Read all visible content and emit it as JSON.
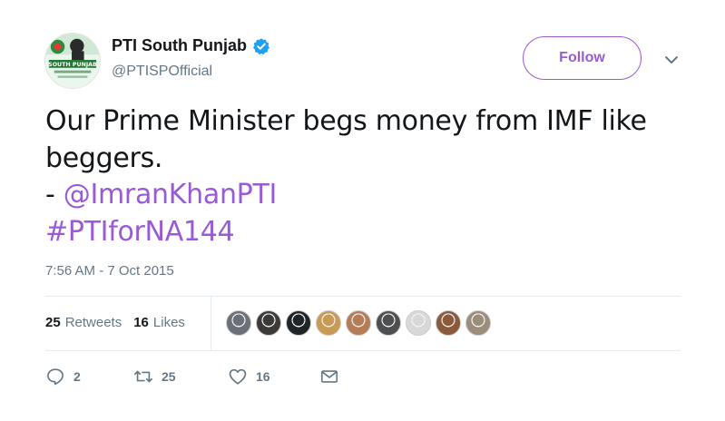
{
  "user": {
    "display_name": "PTI South Punjab",
    "handle": "@PTISPOfficial",
    "avatar_text": "SOUTH PUNJAB"
  },
  "follow_label": "Follow",
  "tweet": {
    "line1": "Our Prime Minister begs money from IMF like",
    "line2": "beggers.",
    "line3_prefix": "- ",
    "mention": "@ImranKhanPTI",
    "hashtag": "#PTIforNA144"
  },
  "timestamp": "7:56 AM - 7 Oct 2015",
  "stats": {
    "retweets_count": "25",
    "retweets_label": "Retweets",
    "likes_count": "16",
    "likes_label": "Likes"
  },
  "liker_avatars": [
    "#6a6f78",
    "#3c3a38",
    "#1f2427",
    "#c89a55",
    "#b57d57",
    "#4d4f50",
    "#d8d8d8",
    "#8a5a3a",
    "#9a8d7a"
  ],
  "actions": {
    "reply_count": "2",
    "retweet_count": "25",
    "like_count": "16"
  },
  "colors": {
    "accent": "#9a5ad6",
    "verified": "#1da1f2",
    "muted": "#657786"
  }
}
